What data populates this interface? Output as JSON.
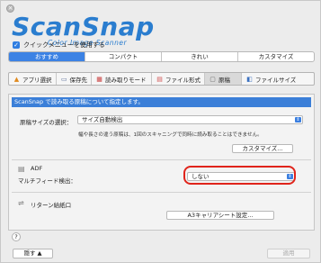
{
  "window": {
    "close_icon": "close-icon"
  },
  "logo": {
    "wordmark": "ScanSnap",
    "tagline": "Color Image Scanner"
  },
  "quick_menu": {
    "label": "クイックメニューを使用する",
    "checked": true
  },
  "profiles": [
    {
      "label": "おすすめ",
      "active": true
    },
    {
      "label": "コンパクト",
      "active": false
    },
    {
      "label": "きれい",
      "active": false
    },
    {
      "label": "カスタマイズ",
      "active": false
    }
  ],
  "tabs": [
    {
      "label": "アプリ選択",
      "icon": "▲",
      "icon_color": "#e08a1e",
      "active": false
    },
    {
      "label": "保存先",
      "icon": "▭",
      "icon_color": "#5a6e9a",
      "active": false
    },
    {
      "label": "読み取りモード",
      "icon": "▦",
      "icon_color": "#c83a3a",
      "active": false
    },
    {
      "label": "ファイル形式",
      "icon": "▤",
      "icon_color": "#d05050",
      "active": false
    },
    {
      "label": "原稿",
      "icon": "▢",
      "icon_color": "#6a6a6a",
      "active": true
    },
    {
      "label": "ファイルサイズ",
      "icon": "◧",
      "icon_color": "#3a70c0",
      "active": false
    }
  ],
  "panel": {
    "banner": "ScanSnap で読み取る原稿について指定します。",
    "paper_size_label": "原稿サイズの選択：",
    "paper_size_value": "サイズ自動検出",
    "paper_size_note": "幅や長さの違う原稿は、1回のスキャニングで同時に読み取ることはできません。",
    "customize_button": "カスタマイズ...",
    "adf_title": "ADF",
    "multifeed_label": "マルチフィード検出：",
    "multifeed_value": "しない",
    "return_title": "リターン給紙口",
    "a3_button": "A3キャリアシート設定..."
  },
  "help_label": "?",
  "footer": {
    "hide_button": "隠す ▲",
    "apply_button": "適用"
  },
  "colors": {
    "accent": "#3b7fd8",
    "logo": "#2a7dcf",
    "highlight": "#e0241b"
  }
}
